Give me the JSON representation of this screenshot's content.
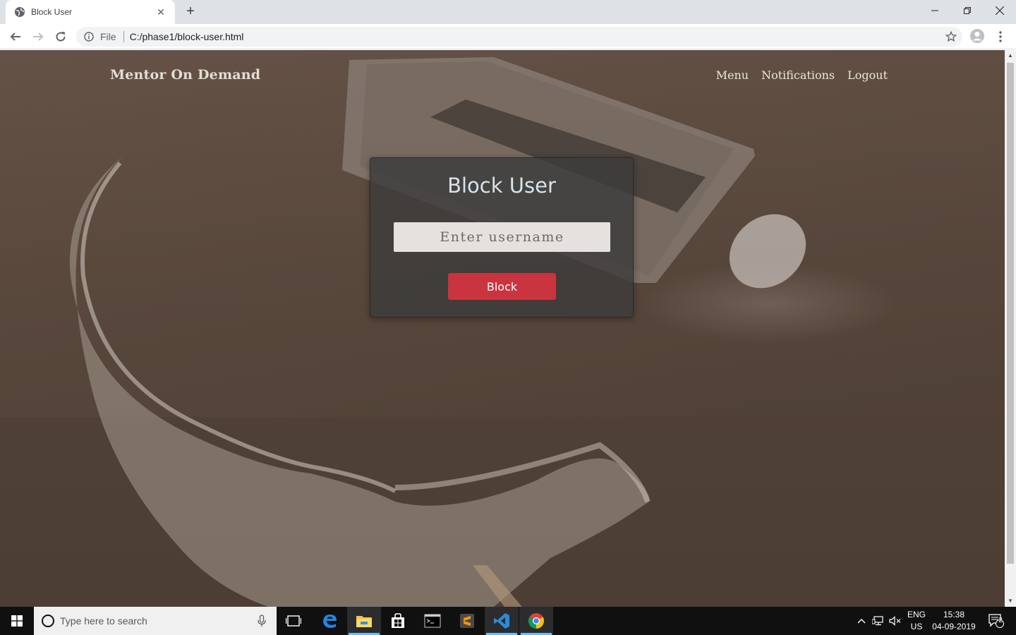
{
  "browser": {
    "tab_title": "Block User",
    "tab_close": "✕",
    "new_tab": "+",
    "window_controls": {
      "minimize": "—",
      "maximize": "❐",
      "close": "✕"
    },
    "address": {
      "scheme_label": "File",
      "url": "C:/phase1/block-user.html"
    }
  },
  "site": {
    "brand": "Mentor On Demand",
    "nav": [
      "Menu",
      "Notifications",
      "Logout"
    ]
  },
  "form": {
    "title": "Block User",
    "username_placeholder": "Enter username",
    "username_value": "",
    "submit_label": "Block"
  },
  "taskbar": {
    "search_placeholder": "Type here to search",
    "lang_top": "ENG",
    "lang_bottom": "US",
    "time": "15:38",
    "date": "04-09-2019",
    "notification_count": "2",
    "pinned": [
      "task-view-icon",
      "edge-icon",
      "file-explorer-icon",
      "store-icon",
      "terminal-icon",
      "sublime-text-icon",
      "vscode-icon",
      "chrome-icon"
    ]
  },
  "colors": {
    "accent_block": "#c9343f",
    "card_bg": "#3c3c3c",
    "taskbar_bg": "#101011",
    "active_indicator": "#76b9ed"
  }
}
